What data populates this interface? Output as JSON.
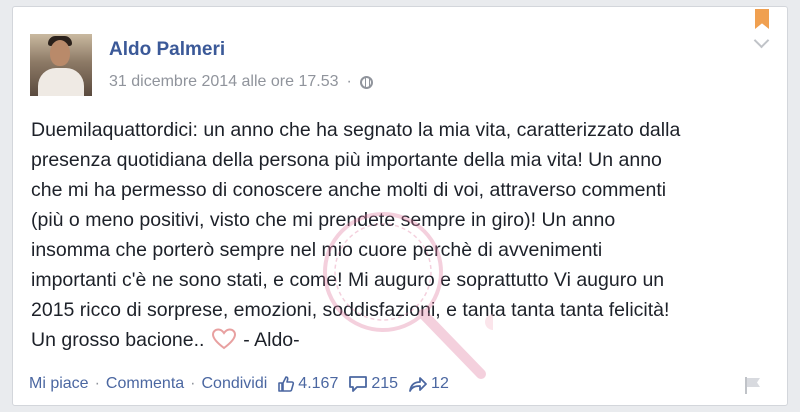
{
  "post": {
    "author": "Aldo Palmeri",
    "date": "31 dicembre 2014 alle ore 17.53",
    "separator": "·",
    "text_lines": [
      "Duemilaquattordici: un anno che ha segnato la mia vita, caratterizzato dalla",
      "presenza quotidiana della persona più importante della mia vita! Un anno",
      "che mi ha permesso di conoscere anche molti di voi, attraverso commenti",
      "(più o meno positivi, visto che mi prendete sempre in giro)! Un anno",
      "insomma che porterò sempre nel mio cuore perchè di avvenimenti",
      "importanti c'è ne sono stati, e come! Mi auguro e soprattutto Vi auguro un",
      "2015 ricco di sorprese, emozioni, soddisfazioni, e tanta tanta tanta felicità!"
    ],
    "last_line_start": "Un grosso bacione..",
    "last_line_end": "- Aldo-"
  },
  "actions": {
    "like": "Mi piace",
    "comment": "Commenta",
    "share": "Condividi",
    "dot": "·"
  },
  "stats": {
    "likes": "4.167",
    "comments": "215",
    "shares": "12"
  },
  "colors": {
    "link": "#3b5998",
    "muted": "#90949c",
    "bookmark": "#f0a050",
    "heart": "#e8a0a0"
  },
  "icons": [
    "globe-icon",
    "bookmark-icon",
    "chevron-down-icon",
    "heart-icon",
    "thumbs-up-icon",
    "comment-icon",
    "share-icon",
    "flag-icon"
  ]
}
